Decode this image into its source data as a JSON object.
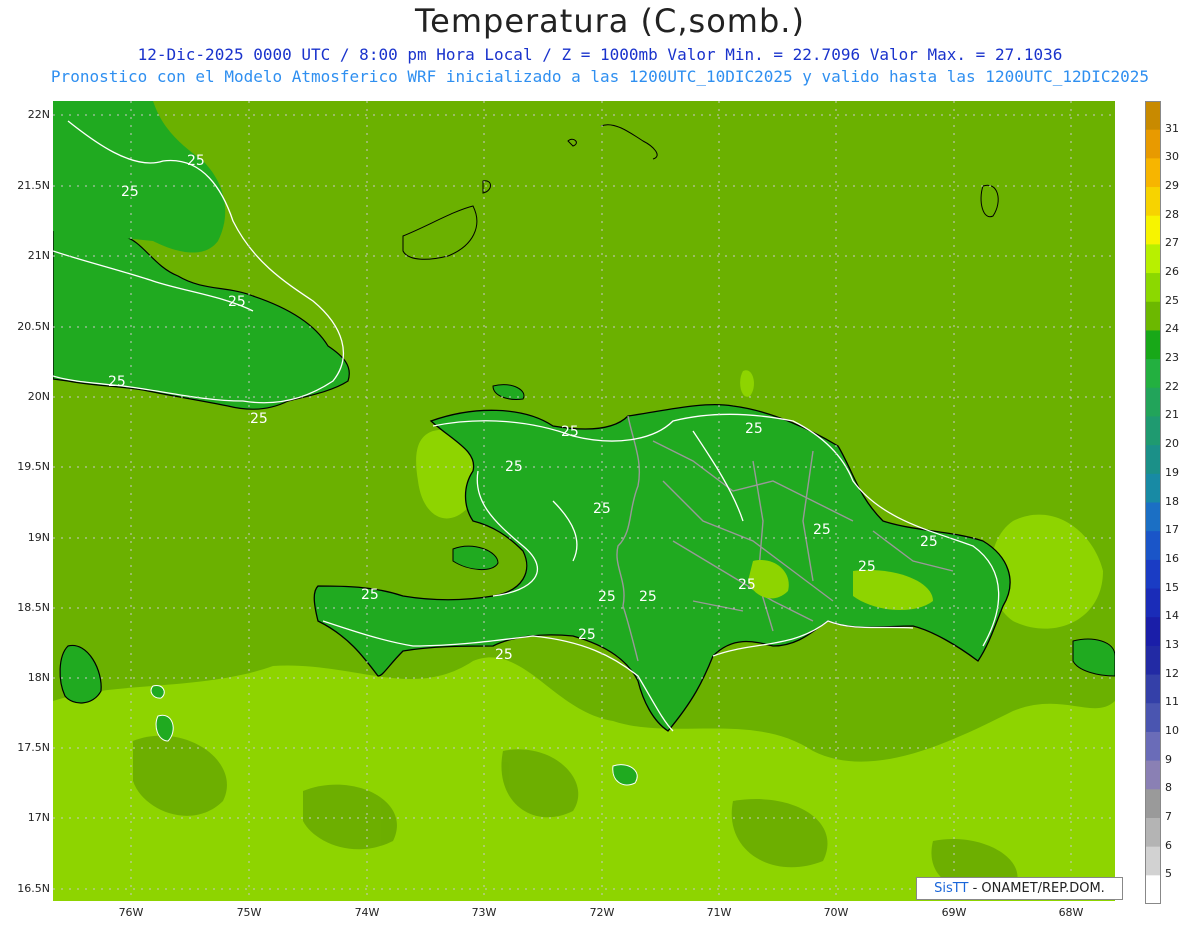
{
  "title": "Temperatura (C,somb.)",
  "subtitle1": "12-Dic-2025  0000 UTC / 8:00 pm Hora Local / Z = 1000mb   Valor Min. = 22.7096  Valor Max. = 27.1036",
  "subtitle2": "Pronostico con el Modelo Atmosferico WRF inicializado a las 1200UTC_10DIC2025 y valido hasta las  1200UTC_12DIC2025",
  "lat_labels": [
    "22N",
    "21.5N",
    "21N",
    "20.5N",
    "20N",
    "19.5N",
    "19N",
    "18.5N",
    "18N",
    "17.5N",
    "17N",
    "16.5N"
  ],
  "lon_labels": [
    "76W",
    "75W",
    "74W",
    "73W",
    "72W",
    "71W",
    "70W",
    "69W",
    "68W"
  ],
  "contour_label": "25",
  "colorbar": {
    "labels": [
      "31",
      "30",
      "29",
      "28",
      "27",
      "26",
      "25",
      "24",
      "23",
      "22",
      "21",
      "20",
      "19",
      "18",
      "17",
      "16",
      "15",
      "14",
      "13",
      "12",
      "11",
      "10",
      "9",
      "8",
      "7",
      "6",
      "5"
    ],
    "colors": [
      "#c88a00",
      "#e89a00",
      "#f7b500",
      "#f7d300",
      "#f7f400",
      "#b8f000",
      "#8cd800",
      "#6cb800",
      "#18a818",
      "#23b040",
      "#22a45a",
      "#1f9a70",
      "#1b9088",
      "#188aa4",
      "#1b6fc4",
      "#1a55c8",
      "#1a3cc4",
      "#1a2cb8",
      "#1a1ea8",
      "#222aa4",
      "#3440a8",
      "#4a55b0",
      "#6a6cb8",
      "#8a80b4",
      "#9a9a9a",
      "#b4b4b4",
      "#d2d2d2",
      "#ffffff"
    ]
  },
  "credit": {
    "brand": "SisTT",
    "text": " - ONAMET/REP.DOM."
  },
  "colors": {
    "ocean": "#6bb100",
    "warm": "#8ed400",
    "cool": "#20aa20",
    "coast": "#000000",
    "border": "#999999",
    "contour": "#ffffff"
  }
}
